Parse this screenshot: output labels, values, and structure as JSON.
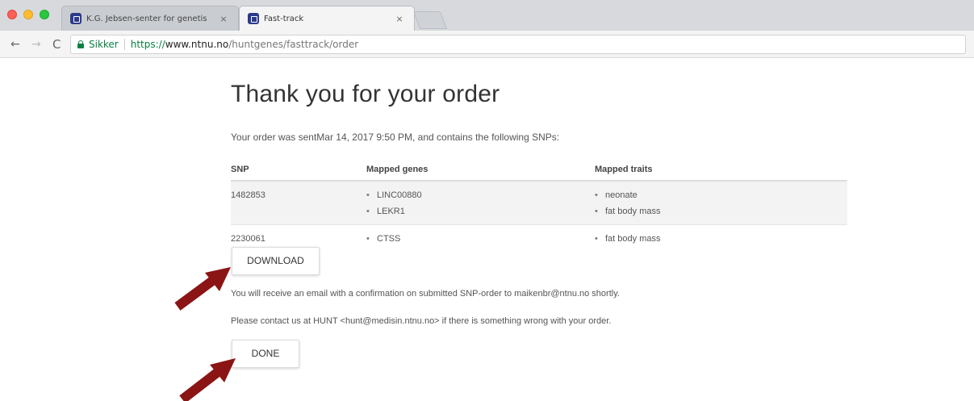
{
  "browser": {
    "tabs": [
      {
        "title": "K.G. Jebsen-senter for genetis",
        "close": "×",
        "active": false
      },
      {
        "title": "Fast-track",
        "close": "×",
        "active": true
      }
    ],
    "nav": {
      "back": "←",
      "forward": "→",
      "reload": "C"
    },
    "address": {
      "secure_label": "Sikker",
      "scheme": "https://",
      "host": "www.ntnu.no",
      "path": "/huntgenes/fasttrack/order"
    }
  },
  "page": {
    "title": "Thank you for your order",
    "order_text": "Your order was sentMar 14, 2017 9:50 PM, and contains the following SNPs:",
    "table": {
      "headers": [
        "SNP",
        "Mapped genes",
        "Mapped traits"
      ],
      "rows": [
        {
          "snp": "1482853",
          "genes": [
            "LINC00880",
            "LEKR1"
          ],
          "traits": [
            "neonate",
            "fat body mass"
          ]
        },
        {
          "snp": "2230061",
          "genes": [
            "CTSS"
          ],
          "traits": [
            "fat body mass"
          ]
        }
      ]
    },
    "download_label": "DOWNLOAD",
    "email_message": "You will receive an email with a confirmation on submitted SNP-order to maikenbr@ntnu.no shortly.",
    "contact_message": "Please contact us at HUNT <hunt@medisin.ntnu.no> if there is something wrong with your order.",
    "done_label": "DONE"
  },
  "colors": {
    "arrow": "#8b1414",
    "secure": "#0b8043",
    "favicon": "#2c3a8c"
  }
}
